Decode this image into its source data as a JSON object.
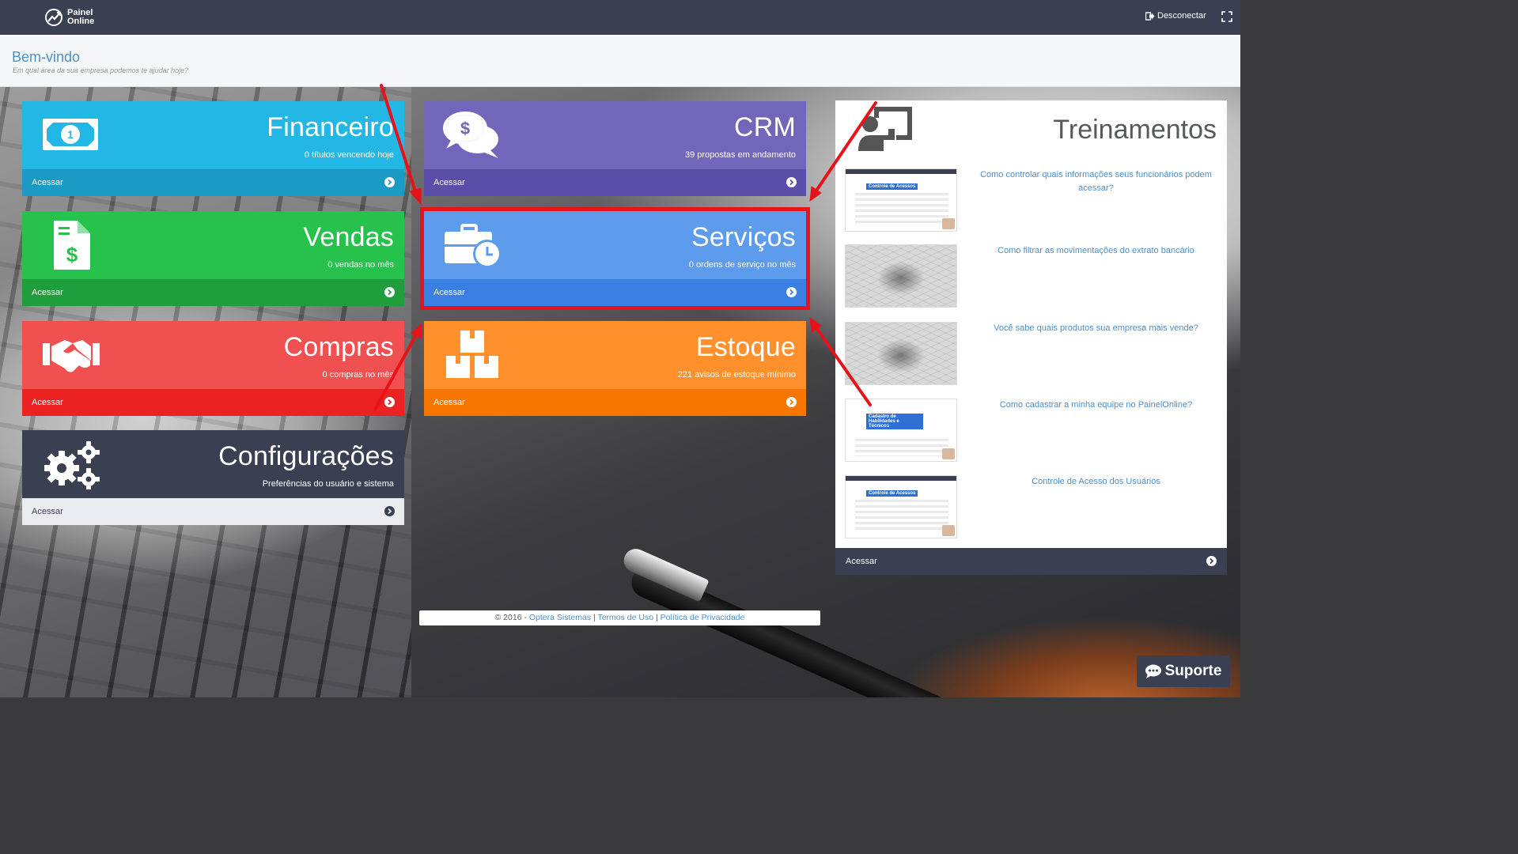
{
  "app": {
    "logo_line1": "Painel",
    "logo_line2": "Online",
    "logout_label": "Desconectar"
  },
  "welcome": {
    "title": "Bem-vindo",
    "subtitle": "Em qual área da sua empresa podemos te ajudar hoje?"
  },
  "modules": {
    "financeiro": {
      "title": "Financeiro",
      "subtitle": "0 títulos vencendo hoje",
      "action": "Acessar",
      "color": "#23b7e5"
    },
    "crm": {
      "title": "CRM",
      "subtitle": "39 propostas em andamento",
      "action": "Acessar",
      "color": "#7266ba"
    },
    "vendas": {
      "title": "Vendas",
      "subtitle": "0 vendas no mês",
      "action": "Acessar",
      "color": "#27c24c"
    },
    "servicos": {
      "title": "Serviços",
      "subtitle": "0 ordens de serviço no mês",
      "action": "Acessar",
      "color": "#5d9cec"
    },
    "compras": {
      "title": "Compras",
      "subtitle": "0 compras no mês",
      "action": "Acessar",
      "color": "#f05050"
    },
    "estoque": {
      "title": "Estoque",
      "subtitle": "221 avisos de estoque mínimo",
      "action": "Acessar",
      "color": "#ff902b"
    },
    "configuracoes": {
      "title": "Configurações",
      "subtitle": "Preferências do usuário e sistema",
      "action": "Acessar",
      "color": "#3a3f51"
    }
  },
  "trainings": {
    "title": "Treinamentos",
    "action": "Acessar",
    "items": [
      {
        "label": "Como controlar quais informações seus funcionários podem acessar?",
        "thumb_tag": "Controle de Acessos"
      },
      {
        "label": "Como filtrar as movimentações do extrato bancário"
      },
      {
        "label": "Você sabe quais produtos sua empresa mais vende?"
      },
      {
        "label": "Como cadastrar a minha equipe no PainelOnline?",
        "thumb_tag": "Cadastro de Habilidades e Técnicos"
      },
      {
        "label": "Controle de Acesso dos Usuários",
        "thumb_tag": "Controle de Acessos"
      }
    ]
  },
  "footer": {
    "copyright": "© 2016 -",
    "company": "Optera Sistemas",
    "sep1": "|",
    "terms": "Termos de Uso",
    "sep2": "|",
    "privacy": "Política de Privacidade"
  },
  "support": {
    "label": "Suporte"
  },
  "colors": {
    "nav": "#3a3f51",
    "link": "#4a90c9",
    "highlight": "#e8121b"
  }
}
